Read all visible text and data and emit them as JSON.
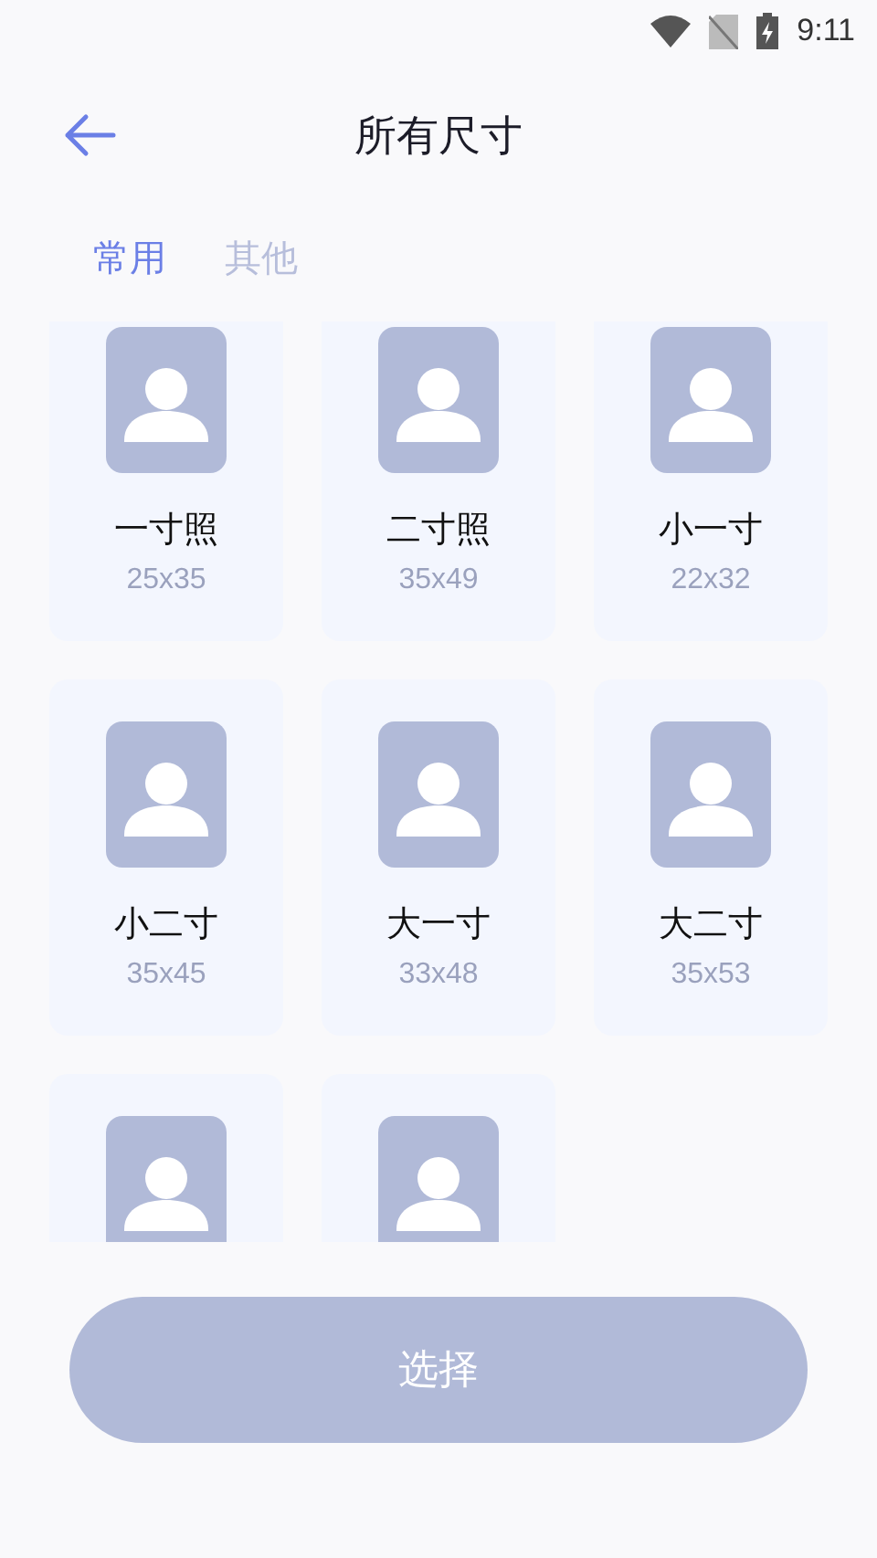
{
  "status_bar": {
    "time": "9:11"
  },
  "header": {
    "title": "所有尺寸"
  },
  "tabs": [
    {
      "label": "常用",
      "selected": true
    },
    {
      "label": "其他",
      "selected": false
    }
  ],
  "sizes": [
    {
      "kind": "full",
      "name": "一寸照",
      "dims": "25x35"
    },
    {
      "kind": "full",
      "name": "二寸照",
      "dims": "35x49"
    },
    {
      "kind": "full",
      "name": "小一寸",
      "dims": "22x32"
    },
    {
      "kind": "full",
      "name": "小二寸",
      "dims": "35x45"
    },
    {
      "kind": "full",
      "name": "大一寸",
      "dims": "33x48"
    },
    {
      "kind": "full",
      "name": "大二寸",
      "dims": "35x53"
    },
    {
      "kind": "cut"
    },
    {
      "kind": "cut"
    }
  ],
  "button": {
    "label": "选择"
  }
}
